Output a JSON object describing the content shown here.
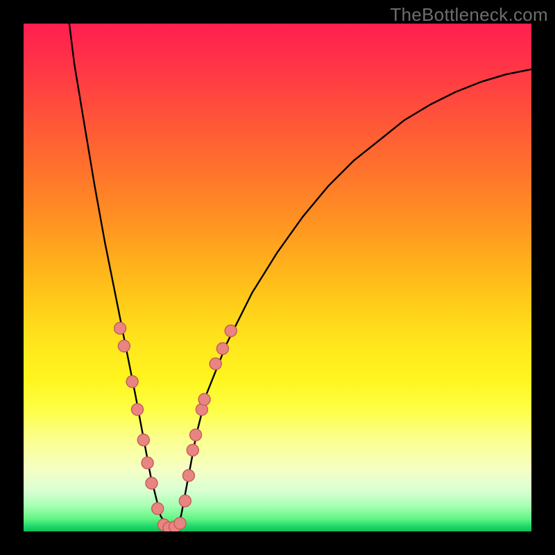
{
  "watermark": "TheBottleneck.com",
  "colors": {
    "frame": "#000000",
    "gradient_top": "#ff1f4f",
    "gradient_bottom": "#0cc057",
    "curve": "#000000",
    "dot_fill": "#e88582",
    "dot_stroke": "#c55a57"
  },
  "chart_data": {
    "type": "line",
    "title": "",
    "xlabel": "",
    "ylabel": "",
    "xlim": [
      0,
      100
    ],
    "ylim": [
      0,
      100
    ],
    "series": [
      {
        "name": "bottleneck-curve",
        "x": [
          9,
          10,
          12,
          14,
          16,
          18,
          20,
          22,
          23.5,
          25,
          27,
          29,
          31,
          32.5,
          34,
          36,
          40,
          45,
          50,
          55,
          60,
          65,
          70,
          75,
          80,
          85,
          90,
          95,
          100
        ],
        "y": [
          100,
          92,
          80,
          68,
          57,
          47,
          37,
          27,
          19,
          11,
          3,
          0,
          3,
          11,
          19,
          27,
          37,
          47,
          55,
          62,
          68,
          73,
          77,
          81,
          84,
          86.5,
          88.5,
          90,
          91
        ]
      }
    ],
    "markers": [
      {
        "name": "left-upper-1",
        "x": 19.0,
        "y": 40.0
      },
      {
        "name": "left-upper-2",
        "x": 19.8,
        "y": 36.5
      },
      {
        "name": "left-mid-1",
        "x": 21.4,
        "y": 29.5
      },
      {
        "name": "left-mid-2",
        "x": 22.4,
        "y": 24.0
      },
      {
        "name": "left-low-1",
        "x": 23.6,
        "y": 18.0
      },
      {
        "name": "left-low-2",
        "x": 24.4,
        "y": 13.5
      },
      {
        "name": "left-low-3",
        "x": 25.2,
        "y": 9.5
      },
      {
        "name": "left-low-4",
        "x": 26.4,
        "y": 4.5
      },
      {
        "name": "bottom-1",
        "x": 27.6,
        "y": 1.3
      },
      {
        "name": "bottom-2",
        "x": 28.6,
        "y": 0.7
      },
      {
        "name": "bottom-3",
        "x": 29.8,
        "y": 0.9
      },
      {
        "name": "bottom-4",
        "x": 30.8,
        "y": 1.6
      },
      {
        "name": "right-low-1",
        "x": 31.8,
        "y": 6.0
      },
      {
        "name": "right-low-2",
        "x": 32.5,
        "y": 11.0
      },
      {
        "name": "right-low-3",
        "x": 33.3,
        "y": 16.0
      },
      {
        "name": "right-low-4",
        "x": 33.9,
        "y": 19.0
      },
      {
        "name": "right-mid-1",
        "x": 35.1,
        "y": 24.0
      },
      {
        "name": "right-mid-2",
        "x": 35.6,
        "y": 26.0
      },
      {
        "name": "right-upper-1",
        "x": 37.8,
        "y": 33.0
      },
      {
        "name": "right-upper-2",
        "x": 39.2,
        "y": 36.0
      },
      {
        "name": "right-upper-3",
        "x": 40.8,
        "y": 39.5
      }
    ]
  }
}
